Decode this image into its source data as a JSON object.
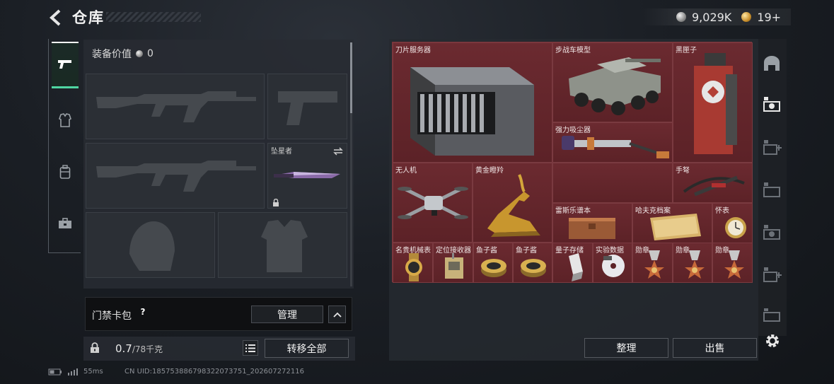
{
  "header": {
    "title": "仓库",
    "currency": [
      {
        "icon": "silver-coin-icon",
        "value": "9,029K"
      },
      {
        "icon": "gold-coin-icon",
        "value": "19+"
      }
    ]
  },
  "left_nav": {
    "items": [
      {
        "name": "weapon-icon",
        "active": true
      },
      {
        "name": "armor-icon",
        "active": false
      },
      {
        "name": "backpack-icon",
        "active": false
      },
      {
        "name": "toolbox-icon",
        "active": false
      }
    ]
  },
  "equipment": {
    "value_label": "装备价值",
    "value": "0",
    "melee_slot_label": "坠星者"
  },
  "card_pack": {
    "label": "门禁卡包",
    "help": "?",
    "manage_label": "管理"
  },
  "inventory": {
    "weight": "0.7",
    "weight_max": "/78千克",
    "transfer_label": "转移全部"
  },
  "stash": {
    "items": [
      {
        "label": "刀片服务器"
      },
      {
        "label": "步战车模型"
      },
      {
        "label": "黑匣子"
      },
      {
        "label": "强力吸尘器"
      },
      {
        "label": "无人机"
      },
      {
        "label": "黄金瞪羚"
      },
      {
        "label": "手弩"
      },
      {
        "label": "雷斯乐谱本"
      },
      {
        "label": "哈夫克档案"
      },
      {
        "label": "怀表"
      },
      {
        "label": "名贵机械表"
      },
      {
        "label": "定位接收器"
      },
      {
        "label": "鱼子酱"
      },
      {
        "label": "鱼子酱"
      },
      {
        "label": "量子存储"
      },
      {
        "label": "实验数据"
      },
      {
        "label": "勋章"
      },
      {
        "label": "勋章"
      },
      {
        "label": "勋章"
      }
    ],
    "sort_label": "整理",
    "sell_label": "出售"
  },
  "footer": {
    "ping": "55ms",
    "uid": "CN UID:185753886798322073751_202607272116"
  },
  "colors": {
    "accent": "#4fd6a2",
    "stash_bg": "#5c2227"
  }
}
